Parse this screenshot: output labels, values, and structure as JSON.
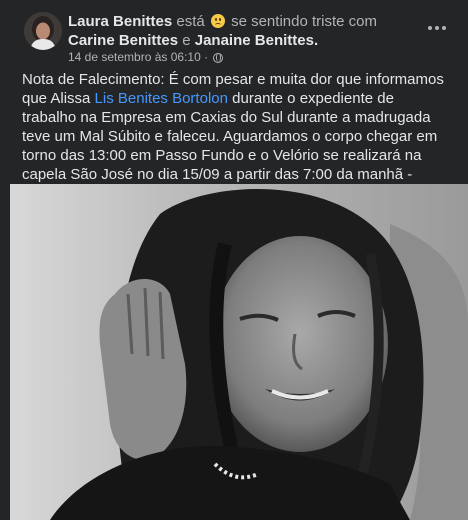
{
  "post": {
    "author": "Laura Benittes",
    "feeling_prefix": "está",
    "feeling_text": "se sentindo triste com",
    "tagged_1": "Carine Benittes",
    "connector": "e",
    "tagged_2": "Janaine Benittes",
    "timestamp": "14 de setembro às 06:10",
    "separator": "·",
    "privacy_icon": "globe-icon",
    "more_icon": "ellipsis-icon",
    "text_part1": "Nota de Falecimento: É com pesar e muita dor que informamos que Alissa ",
    "mentioned_name": "Lis Benites Bortolon",
    "text_part2": " durante o expediente de trabalho na Empresa em Caxias do Sul durante a madrugada teve um Mal Súbito e faleceu. Aguardamos o corpo chegar em torno das 13:00 em Passo Fundo e o Velório se realizará na capela São José no dia 15/09 a partir das 7:00 da manhã - Passo Fundo.",
    "link_color": "#4599ff",
    "background_color": "#242526"
  }
}
